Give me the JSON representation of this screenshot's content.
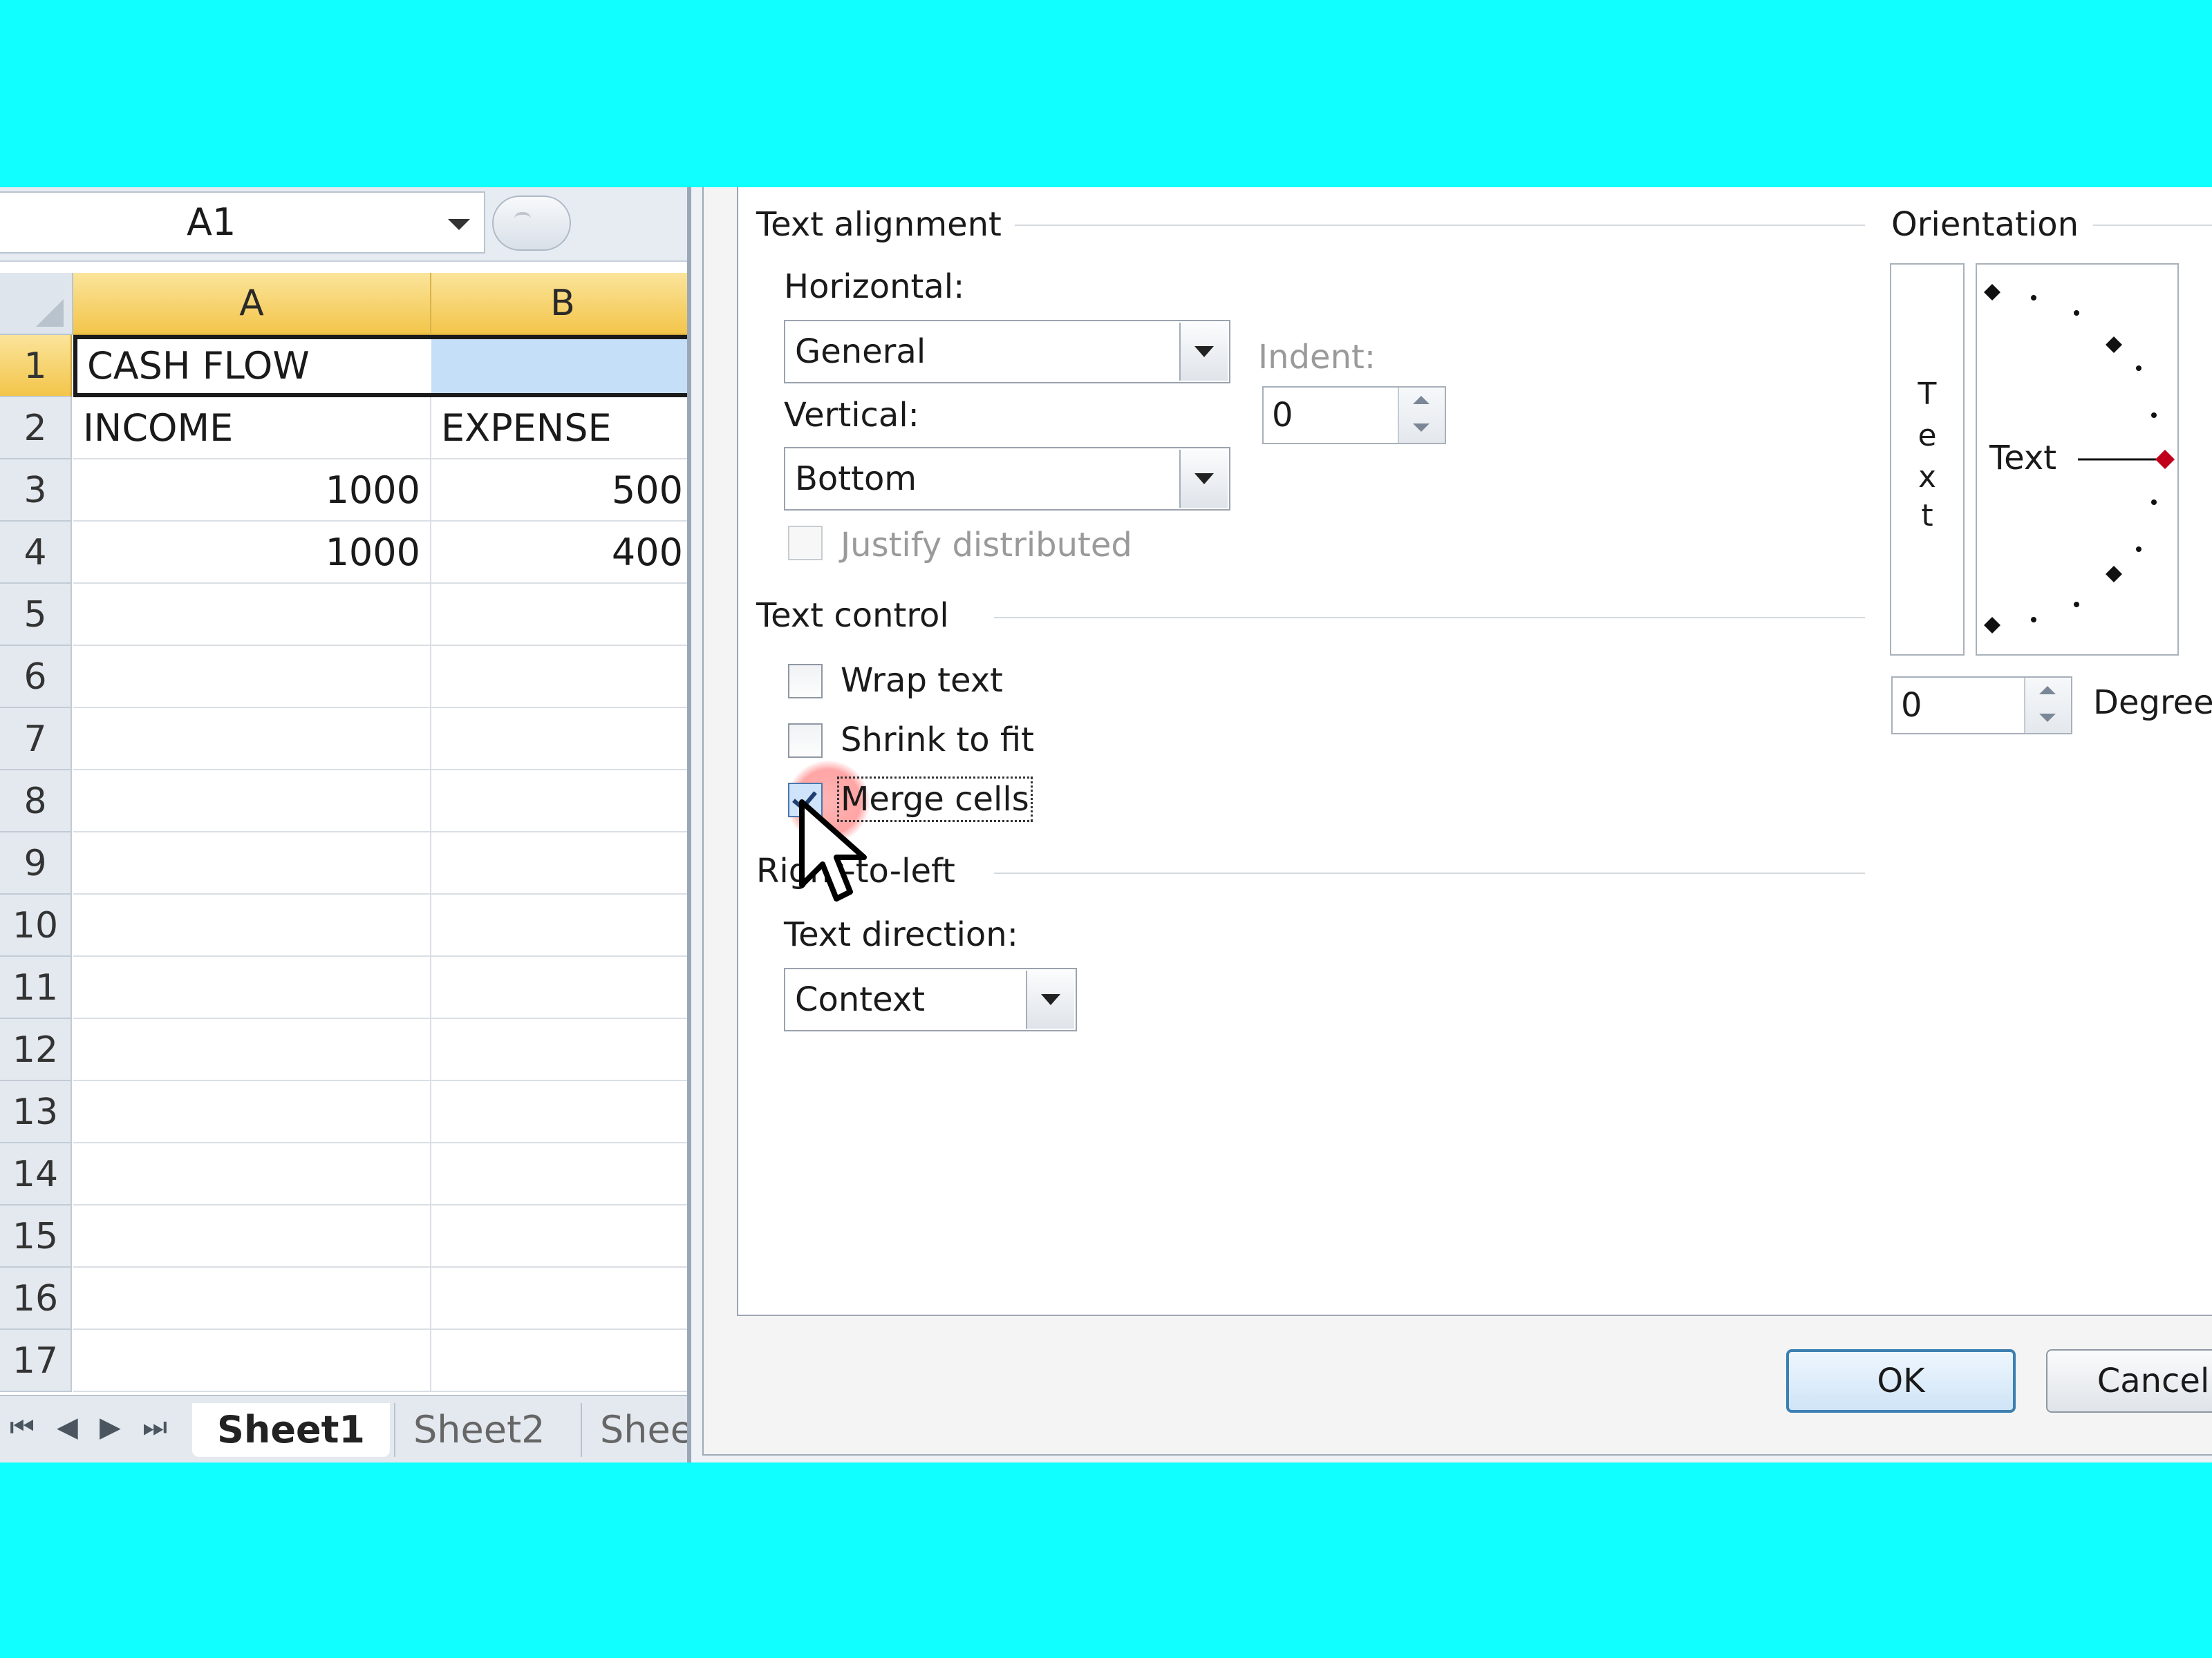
{
  "excel": {
    "name_box": "A1",
    "columns": [
      "A",
      "B"
    ],
    "rows": [
      {
        "n": "1",
        "a": "CASH FLOW",
        "b": ""
      },
      {
        "n": "2",
        "a": "INCOME",
        "b": "EXPENSE"
      },
      {
        "n": "3",
        "a": "1000",
        "b": "500"
      },
      {
        "n": "4",
        "a": "1000",
        "b": "400"
      },
      {
        "n": "5",
        "a": "",
        "b": ""
      },
      {
        "n": "6",
        "a": "",
        "b": ""
      },
      {
        "n": "7",
        "a": "",
        "b": ""
      },
      {
        "n": "8",
        "a": "",
        "b": ""
      },
      {
        "n": "9",
        "a": "",
        "b": ""
      },
      {
        "n": "10",
        "a": "",
        "b": ""
      },
      {
        "n": "11",
        "a": "",
        "b": ""
      },
      {
        "n": "12",
        "a": "",
        "b": ""
      },
      {
        "n": "13",
        "a": "",
        "b": ""
      },
      {
        "n": "14",
        "a": "",
        "b": ""
      },
      {
        "n": "15",
        "a": "",
        "b": ""
      },
      {
        "n": "16",
        "a": "",
        "b": ""
      },
      {
        "n": "17",
        "a": "",
        "b": ""
      }
    ],
    "sheet_tabs": [
      "Sheet1",
      "Sheet2",
      "Shee"
    ],
    "nav_icons": [
      "first-sheet-icon",
      "prev-sheet-icon",
      "next-sheet-icon",
      "last-sheet-icon"
    ]
  },
  "dialog": {
    "text_alignment": {
      "group_label": "Text alignment",
      "horizontal_label": "Horizontal:",
      "horizontal_value": "General",
      "indent_label": "Indent:",
      "indent_value": "0",
      "vertical_label": "Vertical:",
      "vertical_value": "Bottom",
      "justify_distributed_label": "Justify distributed"
    },
    "text_control": {
      "group_label": "Text control",
      "wrap_text_label": "Wrap text",
      "shrink_to_fit_label": "Shrink to fit",
      "merge_cells_label": "Merge cells",
      "wrap_text_checked": false,
      "shrink_to_fit_checked": false,
      "merge_cells_checked": true
    },
    "right_to_left": {
      "group_label": "Right-to-left",
      "text_direction_label": "Text direction:",
      "text_direction_value": "Context"
    },
    "orientation": {
      "group_label": "Orientation",
      "vertical_text_letters": [
        "T",
        "e",
        "x",
        "t"
      ],
      "dial_text": "Text",
      "degrees_value": "0",
      "degrees_label": "Degrees"
    },
    "ok_label": "OK",
    "cancel_label": "Cancel"
  },
  "colors": {
    "background": "#10ffff",
    "header_selected": "#f3c54a",
    "selection_fill": "#c6dff8",
    "dial_marker": "#c0001a"
  }
}
